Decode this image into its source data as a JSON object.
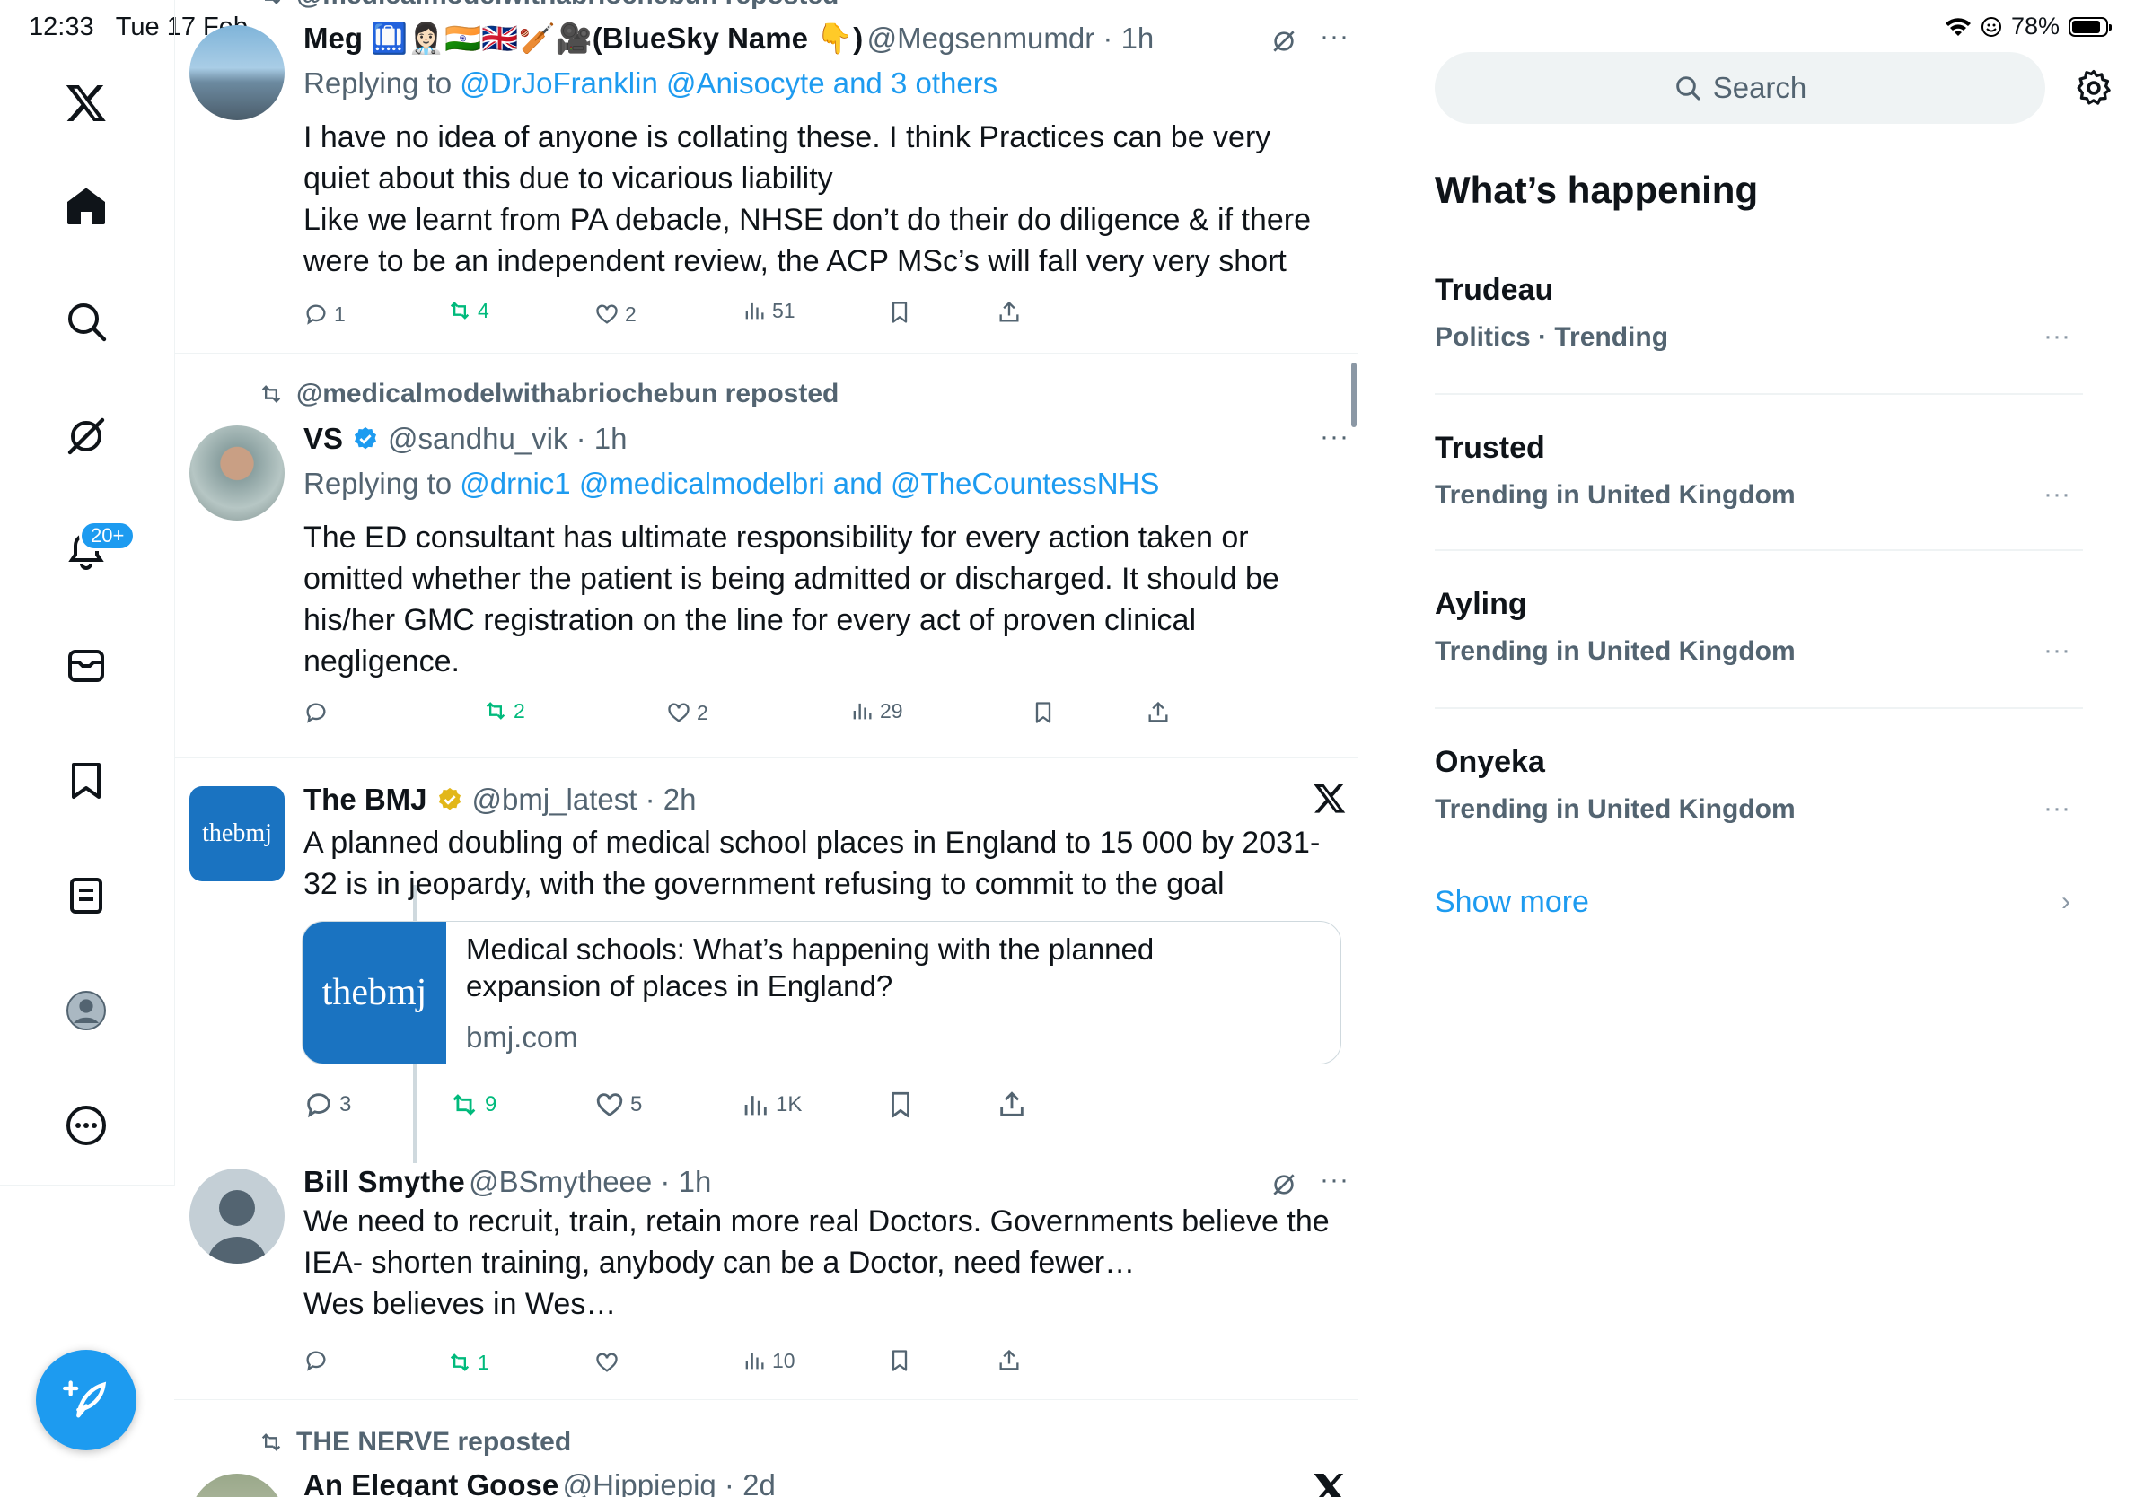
{
  "status": {
    "time": "12:33",
    "date": "Tue 17 Feb",
    "battery": "78%"
  },
  "nav": {
    "badge": "20+"
  },
  "tweets": [
    {
      "repost_by": "@medicalmodelwithabriochebun reposted",
      "name": "Meg 🛄👩🏻‍⚕️🇮🇳🇬🇧🏏🎥(BlueSky Name 👇)",
      "handle": "@Megsenmumdr · 1h",
      "reply_prefix": "Replying to ",
      "reply_to": "@DrJoFranklin @Anisocyte and 3 others",
      "body": "I have no idea of anyone is collating these. I think Practices can be very quiet about this due to vicarious liability\nLike we learnt from PA debacle, NHSE don’t do their do diligence & if there were to be an independent review, the ACP MSc’s will fall very very short",
      "replies": "1",
      "reposts": "4",
      "likes": "2",
      "views": "51"
    },
    {
      "repost_by": "@medicalmodelwithabriochebun reposted",
      "name": "VS",
      "handle": "@sandhu_vik · 1h",
      "reply_prefix": "Replying to ",
      "reply_to": "@drnic1 @medicalmodelbri and @TheCountessNHS",
      "body": "The ED consultant has ultimate responsibility for every action taken or omitted whether the patient is being admitted or discharged. It should be his/her GMC registration on the line for every act of proven clinical negligence.",
      "replies": "",
      "reposts": "2",
      "likes": "2",
      "views": "29"
    },
    {
      "name": "The BMJ",
      "handle": "@bmj_latest · 2h",
      "avatar_text": "thebmj",
      "body": "A planned doubling of medical school places in England to 15 000 by 2031-32 is in jeopardy, with the government refusing to commit to the goal",
      "card_title": "Medical schools: What’s happening with the planned expansion of places in England?",
      "card_domain": "bmj.com",
      "card_img_text": "thebmj",
      "replies": "3",
      "reposts": "9",
      "likes": "5",
      "views": "1K"
    },
    {
      "name": "Bill Smythe",
      "handle": "@BSmytheee · 1h",
      "body": "We need to recruit, train, retain more real Doctors. Governments believe the IEA- shorten training, anybody can be a Doctor, need fewer…\nWes believes in Wes…",
      "replies": "",
      "reposts": "1",
      "likes": "",
      "views": "10"
    },
    {
      "repost_by": "THE NERVE reposted",
      "name": "An Elegant Goose",
      "handle": "@Hippiepig · 2d"
    }
  ],
  "right": {
    "search_placeholder": "Search",
    "title": "What’s happening",
    "trends": [
      {
        "name": "Trudeau",
        "meta": "Politics · Trending"
      },
      {
        "name": "Trusted",
        "meta": "Trending in United Kingdom"
      },
      {
        "name": "Ayling",
        "meta": "Trending in United Kingdom"
      },
      {
        "name": "Onyeka",
        "meta": "Trending in United Kingdom"
      }
    ],
    "show_more": "Show more"
  }
}
